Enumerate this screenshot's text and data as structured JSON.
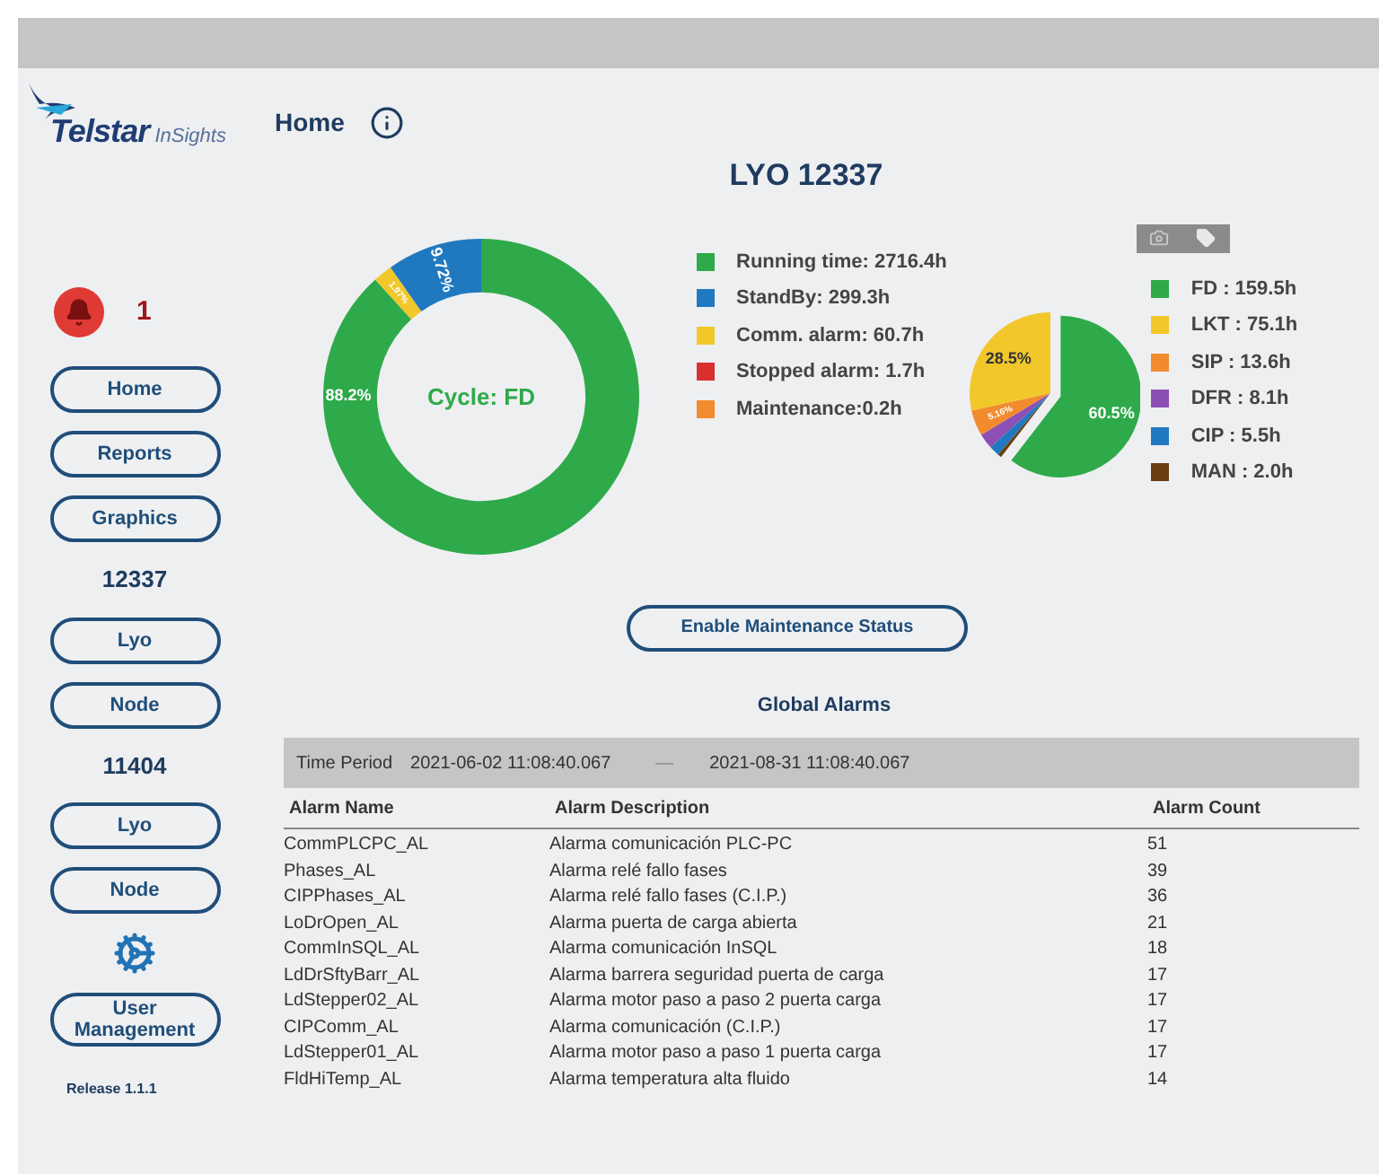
{
  "logo": {
    "brand": "Telstar",
    "product": "InSights"
  },
  "header": {
    "title": "Home"
  },
  "alarm_indicator": {
    "count": "1"
  },
  "sidebar": {
    "items": [
      {
        "kind": "button",
        "label": "Home"
      },
      {
        "kind": "button",
        "label": "Reports"
      },
      {
        "kind": "button",
        "label": "Graphics"
      },
      {
        "kind": "heading",
        "label": "12337"
      },
      {
        "kind": "button",
        "label": "Lyo"
      },
      {
        "kind": "button",
        "label": "Node"
      },
      {
        "kind": "heading",
        "label": "11404"
      },
      {
        "kind": "button",
        "label": "Lyo"
      },
      {
        "kind": "button",
        "label": "Node"
      },
      {
        "kind": "settings"
      },
      {
        "kind": "button",
        "label": "User Management"
      }
    ],
    "release": "Release 1.1.1"
  },
  "page_title": "LYO 12337",
  "status_chart": {
    "center_label": "Cycle: FD",
    "chart_data": {
      "type": "donut",
      "categories": [
        "Running time: 2716.4h",
        "StandBy: 299.3h",
        "Comm. alarm: 60.7h",
        "Stopped alarm: 1.7h",
        "Maintenance:0.2h"
      ],
      "values": [
        88.2,
        9.72,
        1.97,
        null,
        null
      ],
      "colors": [
        "#2eaa4a",
        "#2079c0",
        "#f2c72a",
        "#d9302f",
        "#f28a2e"
      ],
      "value_labels": [
        "88.2%",
        "9.72%",
        "1.97%",
        null,
        null
      ]
    }
  },
  "cycle_chart": {
    "chart_data": {
      "type": "pie",
      "categories": [
        "FD : 159.5h",
        "LKT : 75.1h",
        "SIP : 13.6h",
        "DFR : 8.1h",
        "CIP : 5.5h",
        "MAN : 2.0h"
      ],
      "values": [
        60.5,
        28.5,
        5.16,
        3.06,
        2.08,
        0.76
      ],
      "colors": [
        "#2eaa4a",
        "#f2c72a",
        "#f28a2e",
        "#8c4fb3",
        "#2079c0",
        "#6b3e12"
      ],
      "value_labels": [
        "60.5%",
        "28.5%",
        "5.16%",
        null,
        null,
        null
      ]
    }
  },
  "maintenance_button": "Enable Maintenance Status",
  "alarms": {
    "title": "Global Alarms",
    "period_label": "Time Period",
    "period_start": "2021-06-02 11:08:40.067",
    "period_separator": "—",
    "period_end": "2021-08-31 11:08:40.067",
    "columns": [
      "Alarm Name",
      "Alarm Description",
      "Alarm Count"
    ],
    "rows": [
      [
        "CommPLCPC_AL",
        "Alarma comunicación PLC-PC",
        "51"
      ],
      [
        "Phases_AL",
        "Alarma relé fallo fases",
        "39"
      ],
      [
        "CIPPhases_AL",
        "Alarma relé fallo fases (C.I.P.)",
        "36"
      ],
      [
        "LoDrOpen_AL",
        "Alarma puerta de carga abierta",
        "21"
      ],
      [
        "CommInSQL_AL",
        "Alarma comunicación InSQL",
        "18"
      ],
      [
        "LdDrSftyBarr_AL",
        "Alarma barrera seguridad puerta de carga",
        "17"
      ],
      [
        "LdStepper02_AL",
        "Alarma motor paso a paso 2 puerta carga",
        "17"
      ],
      [
        "CIPComm_AL",
        "Alarma comunicación (C.I.P.)",
        "17"
      ],
      [
        "LdStepper01_AL",
        "Alarma motor paso a paso 1 puerta carga",
        "17"
      ],
      [
        "FldHiTemp_AL",
        "Alarma temperatura alta fluido",
        "14"
      ]
    ]
  }
}
